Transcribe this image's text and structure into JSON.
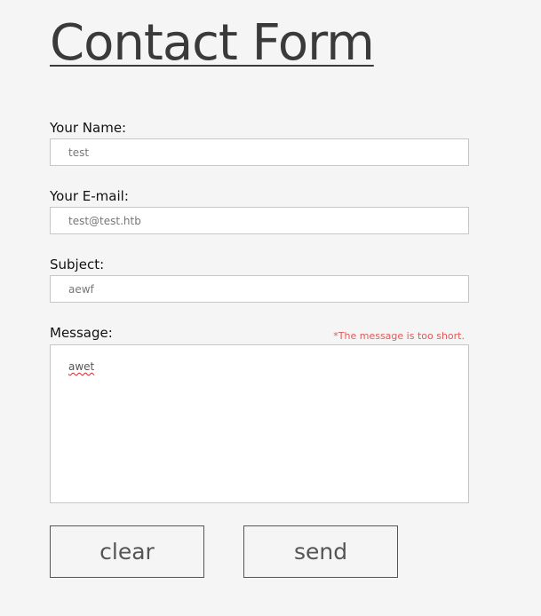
{
  "form": {
    "title": "Contact Form",
    "name": {
      "label": "Your Name:",
      "value": "test"
    },
    "email": {
      "label": "Your E-mail:",
      "value": "test@test.htb"
    },
    "subject": {
      "label": "Subject:",
      "value": "aewf"
    },
    "message": {
      "label": "Message:",
      "value": "awet",
      "error": "*The message is too short."
    },
    "buttons": {
      "clear": "clear",
      "send": "send"
    }
  },
  "colors": {
    "background": "#f5f5f5",
    "error": "#e05a5a",
    "title": "#3a3a3a"
  }
}
